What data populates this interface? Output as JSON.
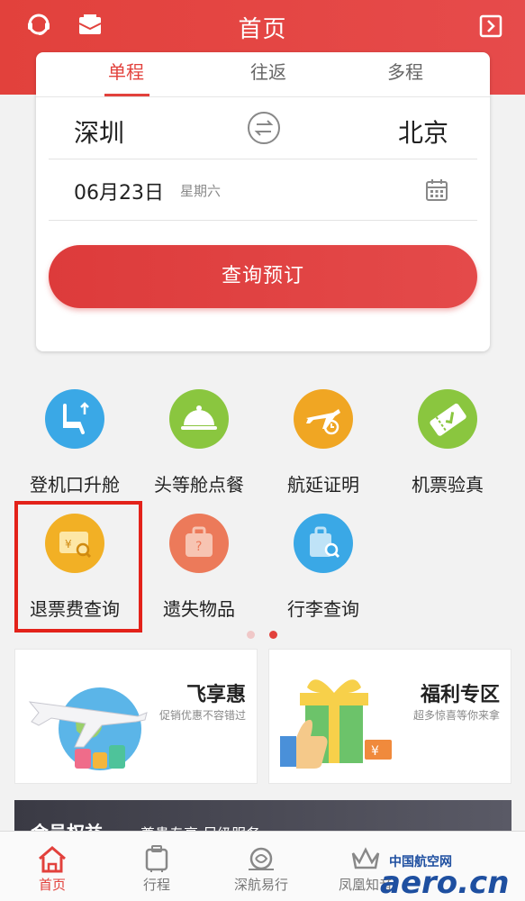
{
  "header": {
    "title": "首页"
  },
  "booking": {
    "tabs": [
      "单程",
      "往返",
      "多程"
    ],
    "from_city": "深圳",
    "to_city": "北京",
    "date": "06月23日",
    "weekday": "星期六",
    "search_label": "查询预订"
  },
  "services": [
    {
      "label": "登机口升舱",
      "icon": "seat-upgrade-icon",
      "color": "#3aa8e6"
    },
    {
      "label": "头等舱点餐",
      "icon": "meal-cloche-icon",
      "color": "#8ac63f"
    },
    {
      "label": "航延证明",
      "icon": "plane-delay-icon",
      "color": "#f0a623"
    },
    {
      "label": "机票验真",
      "icon": "ticket-verify-icon",
      "color": "#8ac63f"
    },
    {
      "label": "退票费查询",
      "icon": "refund-query-icon",
      "color": "#f2b025"
    },
    {
      "label": "遗失物品",
      "icon": "lost-item-icon",
      "color": "#ec7a5a"
    },
    {
      "label": "行李查询",
      "icon": "luggage-search-icon",
      "color": "#3aa8e6"
    }
  ],
  "promos": [
    {
      "title": "飞享惠",
      "subtitle": "促销优惠不容错过"
    },
    {
      "title": "福利专区",
      "subtitle": "超多惊喜等你来拿"
    }
  ],
  "member": {
    "title": "会员权益",
    "subtitle": "尊贵专享 尽级服务"
  },
  "tabbar": [
    {
      "label": "首页",
      "icon": "home-icon",
      "active": true
    },
    {
      "label": "行程",
      "icon": "itinerary-icon",
      "active": false
    },
    {
      "label": "深航易行",
      "icon": "travel-icon",
      "active": false
    },
    {
      "label": "凤凰知音",
      "icon": "crown-icon",
      "active": false
    }
  ],
  "watermark": {
    "cn": "中国航空网",
    "en": "aero.cn"
  },
  "colors": {
    "brand_red": "#e2413c",
    "highlight_red": "#e3221a"
  }
}
